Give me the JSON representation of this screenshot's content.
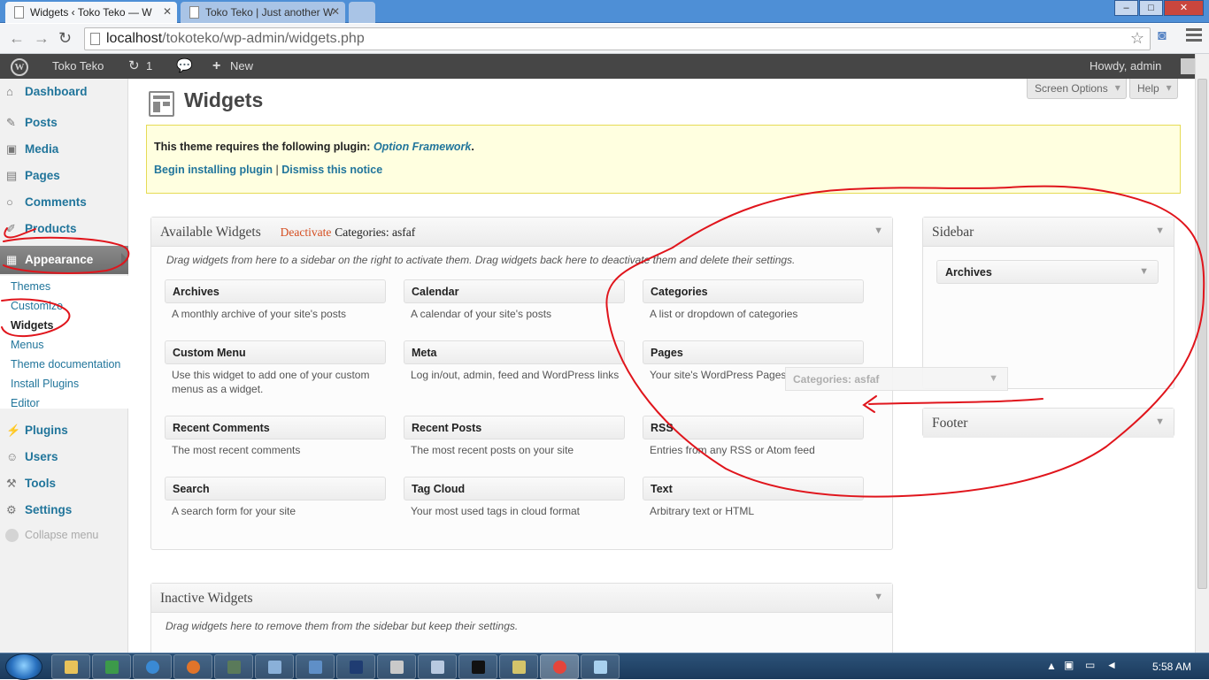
{
  "browser": {
    "tabs": [
      {
        "title": "Widgets ‹ Toko Teko — W",
        "active": true
      },
      {
        "title": "Toko Teko | Just another W",
        "active": false
      }
    ],
    "url_host": "localhost",
    "url_path": "/tokoteko/wp-admin/widgets.php",
    "window_controls": [
      "minimize",
      "maximize",
      "close"
    ]
  },
  "adminbar": {
    "site_name": "Toko Teko",
    "updates_count": "1",
    "new_label": "New",
    "howdy": "Howdy, admin"
  },
  "sidebar": {
    "items": [
      {
        "label": "Dashboard",
        "icon": "dashboard-icon"
      },
      {
        "label": "Posts",
        "icon": "pin-icon"
      },
      {
        "label": "Media",
        "icon": "media-icon"
      },
      {
        "label": "Pages",
        "icon": "pages-icon"
      },
      {
        "label": "Comments",
        "icon": "comment-icon"
      },
      {
        "label": "Products",
        "icon": "products-icon"
      },
      {
        "label": "Appearance",
        "icon": "appearance-icon"
      },
      {
        "label": "Plugins",
        "icon": "plug-icon"
      },
      {
        "label": "Users",
        "icon": "users-icon"
      },
      {
        "label": "Tools",
        "icon": "tools-icon"
      },
      {
        "label": "Settings",
        "icon": "settings-icon"
      }
    ],
    "submenu": [
      "Themes",
      "Customize",
      "Widgets",
      "Menus",
      "Theme documentation",
      "Install Plugins",
      "Editor"
    ],
    "current_sub": "Widgets",
    "collapse": "Collapse menu"
  },
  "header": {
    "screen_options": "Screen Options",
    "help": "Help",
    "title": "Widgets"
  },
  "notice": {
    "text": "This theme requires the following plugin:",
    "plugin_link": "Option Framework",
    "period": ".",
    "begin": "Begin installing plugin",
    "sep": "|",
    "dismiss": "Dismiss this notice"
  },
  "available": {
    "title": "Available Widgets",
    "deactivate": "Deactivate",
    "categories": "Categories: asfaf",
    "description": "Drag widgets from here to a sidebar on the right to activate them. Drag widgets back here to deactivate them and delete their settings.",
    "widgets": [
      {
        "name": "Archives",
        "desc": "A monthly archive of your site's posts"
      },
      {
        "name": "Calendar",
        "desc": "A calendar of your site's posts"
      },
      {
        "name": "Categories",
        "desc": "A list or dropdown of categories"
      },
      {
        "name": "Custom Menu",
        "desc": "Use this widget to add one of your custom menus as a widget."
      },
      {
        "name": "Meta",
        "desc": "Log in/out, admin, feed and WordPress links"
      },
      {
        "name": "Pages",
        "desc": "Your site's WordPress Pages"
      },
      {
        "name": "Recent Comments",
        "desc": "The most recent comments"
      },
      {
        "name": "Recent Posts",
        "desc": "The most recent posts on your site"
      },
      {
        "name": "RSS",
        "desc": "Entries from any RSS or Atom feed"
      },
      {
        "name": "Search",
        "desc": "A search form for your site"
      },
      {
        "name": "Tag Cloud",
        "desc": "Your most used tags in cloud format"
      },
      {
        "name": "Text",
        "desc": "Arbitrary text or HTML"
      }
    ]
  },
  "dragging": {
    "label": "Categories: asfaf"
  },
  "inactive": {
    "title": "Inactive Widgets",
    "description": "Drag widgets here to remove them from the sidebar but keep their settings."
  },
  "areas": {
    "sidebar_title": "Sidebar",
    "sidebar_widget": "Archives",
    "footer_title": "Footer"
  },
  "taskbar": {
    "clock": "5:58 AM"
  },
  "colors": {
    "link": "#21759b",
    "deactivate": "#d54e21",
    "annotation": "#e0151c",
    "adminbar": "#464646"
  }
}
